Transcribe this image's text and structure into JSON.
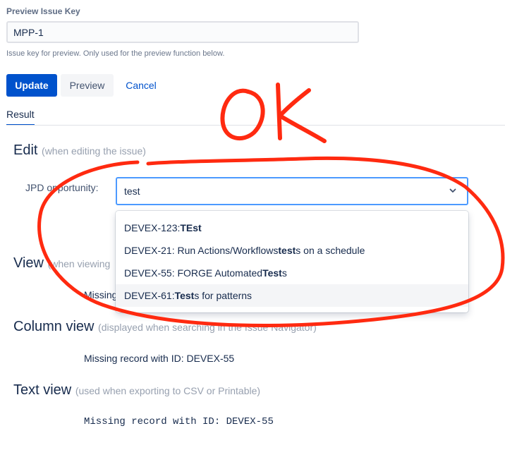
{
  "preview": {
    "label": "Preview Issue Key",
    "value": "MPP-1",
    "help": "Issue key for preview. Only used for the preview function below."
  },
  "buttons": {
    "update": "Update",
    "preview": "Preview",
    "cancel": "Cancel"
  },
  "tabs": {
    "result": "Result"
  },
  "edit": {
    "title": "Edit",
    "note": "(when editing the issue)",
    "field_label": "JPD opportunity:",
    "field_value": "test",
    "options": [
      {
        "pre": "DEVEX-123: ",
        "bold": "TEst",
        "post": ""
      },
      {
        "pre": "DEVEX-21: Run Actions/Workflows ",
        "bold": "test",
        "post": "s on a schedule"
      },
      {
        "pre": "DEVEX-55: FORGE Automated ",
        "bold": "Test",
        "post": "s"
      },
      {
        "pre": "DEVEX-61: ",
        "bold": "Test",
        "post": "s for patterns"
      }
    ]
  },
  "view": {
    "title": "View",
    "note": "(when viewing",
    "value": "Missing"
  },
  "column_view": {
    "title": "Column view",
    "note": "(displayed when searching in the Issue Navigator)",
    "value": "Missing record with ID: DEVEX-55"
  },
  "text_view": {
    "title": "Text view",
    "note": "(used when exporting to CSV or Printable)",
    "value": "Missing record with ID: DEVEX-55"
  },
  "annotation": {
    "text": "OK",
    "color": "#ff2a10"
  },
  "colors": {
    "primary": "#0052cc",
    "focus": "#4c9aff",
    "text": "#172b4d",
    "muted": "#97a0af"
  },
  "icons": {
    "select_indicator": "chevron-down-icon"
  }
}
